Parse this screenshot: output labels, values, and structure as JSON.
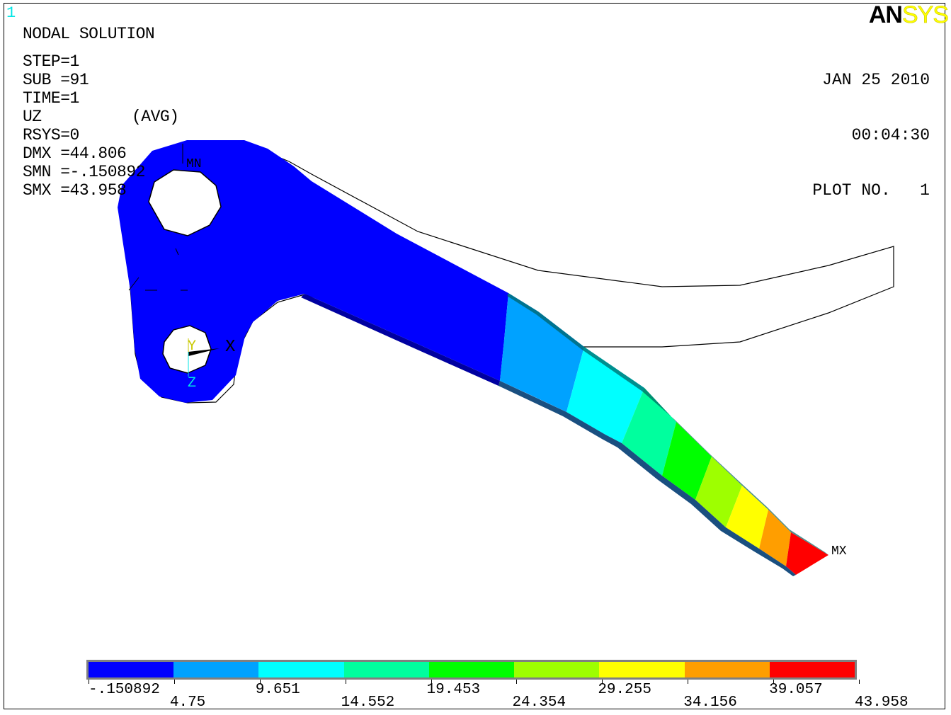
{
  "window_number": "1",
  "logo": {
    "left": "AN",
    "right": "SYS"
  },
  "header": {
    "title": "NODAL SOLUTION",
    "step": "STEP=1",
    "sub": "SUB =91",
    "time": "TIME=1",
    "item": "UZ",
    "avg": "(AVG)",
    "rsys": "RSYS=0",
    "dmx": "DMX =44.806",
    "smn": "SMN =-.150892",
    "smx": "SMX =43.958"
  },
  "date": {
    "date": "JAN 25 2010",
    "time": "00:04:30",
    "plot": "PLOT NO.   1"
  },
  "markers": {
    "min": "MN",
    "max": "MX"
  },
  "triad": {
    "x": "X",
    "y": "Y",
    "z": "Z"
  },
  "legend": {
    "colors": [
      "#0000ff",
      "#00a2ff",
      "#00ffff",
      "#00ff9e",
      "#00ff00",
      "#9eff00",
      "#ffff00",
      "#ff9e00",
      "#ff0000"
    ],
    "top_labels": [
      "-.150892",
      "9.651",
      "19.453",
      "29.255",
      "39.057"
    ],
    "bottom_labels": [
      "4.75",
      "14.552",
      "24.354",
      "34.156",
      "43.958"
    ]
  },
  "colors": {
    "window_number": "#00e5e5",
    "frame": "#000000",
    "undeformed_edge": "#000000"
  }
}
